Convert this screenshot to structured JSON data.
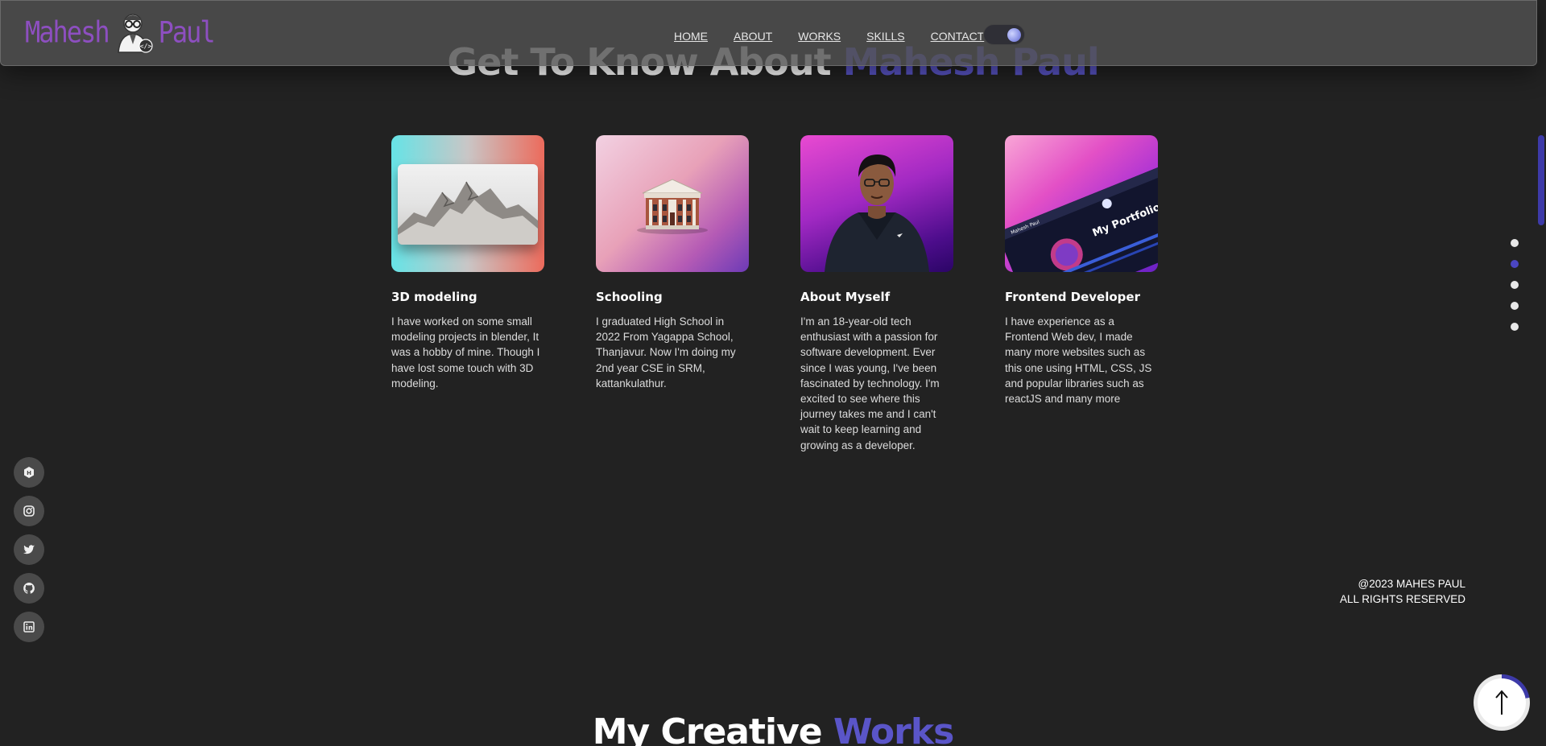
{
  "brand": {
    "first": "Mahesh",
    "last": "Paul"
  },
  "nav": {
    "items": [
      {
        "label": "HOME"
      },
      {
        "label": "ABOUT"
      },
      {
        "label": "WORKS"
      },
      {
        "label": "SKILLS"
      },
      {
        "label": "CONTACT"
      }
    ],
    "theme_icon": "moon-icon"
  },
  "about": {
    "title_prefix": "Get To Know About",
    "title_accent": "Mahesh Paul",
    "cards": [
      {
        "title": "3D modeling",
        "text": "I have worked on some small modeling projects in blender, It was a hobby of mine. Though I have lost some touch with 3D modeling."
      },
      {
        "title": "Schooling",
        "text": "I graduated High School in 2022 From Yagappa School, Thanjavur. Now I'm doing my 2nd year CSE in SRM, kattankulathur."
      },
      {
        "title": "About Myself",
        "text": "I'm an 18-year-old tech enthusiast with a passion for software development. Ever since I was young, I've been fascinated by technology. I'm excited to see where this journey takes me and I can't wait to keep learning and growing as a developer."
      },
      {
        "title": "Frontend Developer",
        "text": "I have experience as a Frontend Web dev, I made many more websites such as this one using HTML, CSS, JS and popular libraries such as reactJS and many more"
      }
    ],
    "card4_image_caption": "My Portfolio",
    "card4_image_tab": "Mahesh Paul"
  },
  "social": [
    {
      "icon": "hashnode-icon"
    },
    {
      "icon": "instagram-icon"
    },
    {
      "icon": "twitter-icon"
    },
    {
      "icon": "github-icon"
    },
    {
      "icon": "linkedin-icon"
    }
  ],
  "section_dots": {
    "count": 5,
    "active_index": 1
  },
  "footer": {
    "line1": "@2023 MAHES PAUL",
    "line2": "ALL RIGHTS RESERVED"
  },
  "works": {
    "title_prefix": "My Creative",
    "title_accent": "Works"
  },
  "colors": {
    "background": "#222222",
    "accent": "#5a55c8",
    "brand": "#8d4fc0"
  },
  "scroll_progress": 0.22
}
